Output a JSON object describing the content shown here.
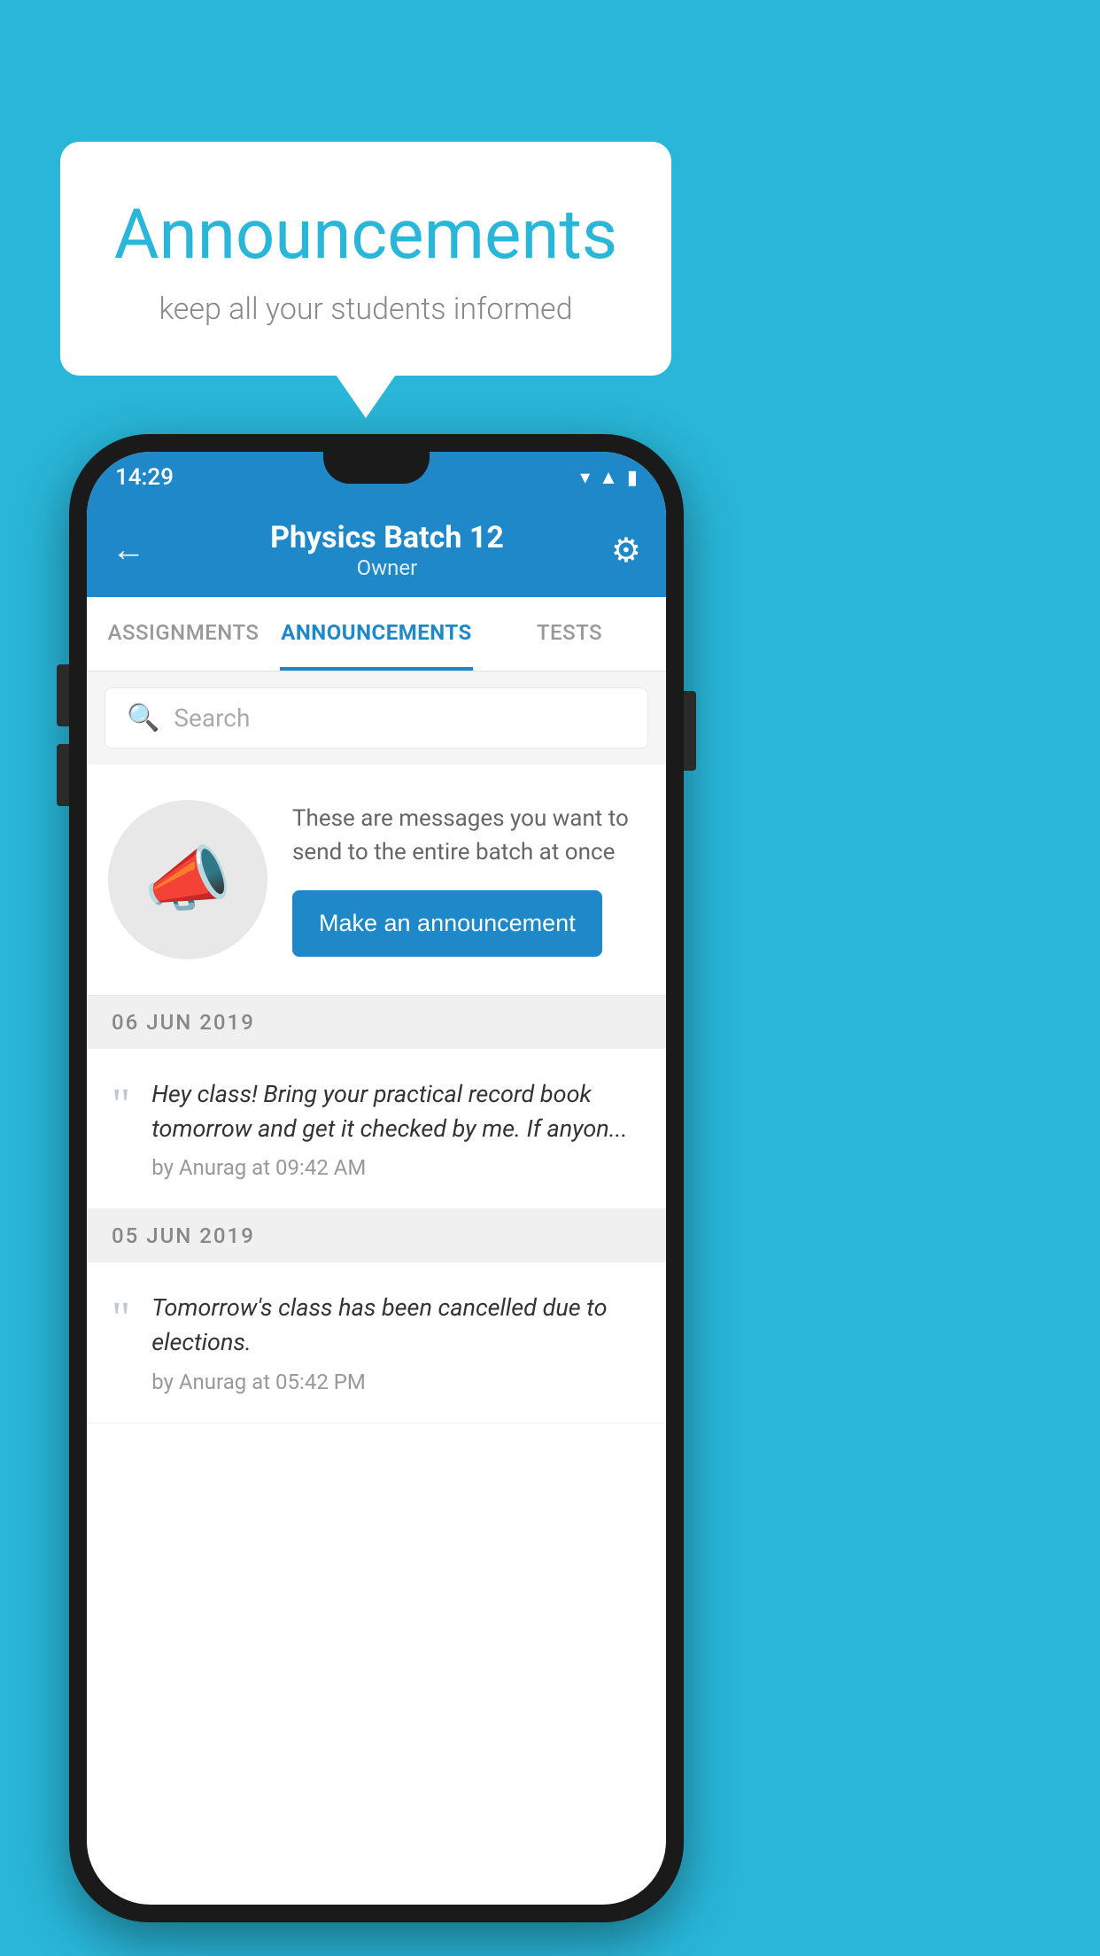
{
  "background_color": "#29B6D8",
  "speech_bubble": {
    "title": "Announcements",
    "subtitle": "keep all your students informed"
  },
  "phone": {
    "status_bar": {
      "time": "14:29",
      "icons": [
        "wifi",
        "signal",
        "battery"
      ]
    },
    "app_bar": {
      "title": "Physics Batch 12",
      "subtitle": "Owner",
      "back_label": "←",
      "gear_label": "⚙"
    },
    "tabs": [
      {
        "label": "ASSIGNMENTS",
        "active": false
      },
      {
        "label": "ANNOUNCEMENTS",
        "active": true
      },
      {
        "label": "TESTS",
        "active": false
      }
    ],
    "search": {
      "placeholder": "Search"
    },
    "promo": {
      "text": "These are messages you want to send to the entire batch at once",
      "button_label": "Make an announcement"
    },
    "announcements": [
      {
        "date": "06  JUN  2019",
        "text": "Hey class! Bring your practical record book tomorrow and get it checked by me. If anyon...",
        "meta": "by Anurag at 09:42 AM"
      },
      {
        "date": "05  JUN  2019",
        "text": "Tomorrow's class has been cancelled due to elections.",
        "meta": "by Anurag at 05:42 PM"
      }
    ]
  }
}
